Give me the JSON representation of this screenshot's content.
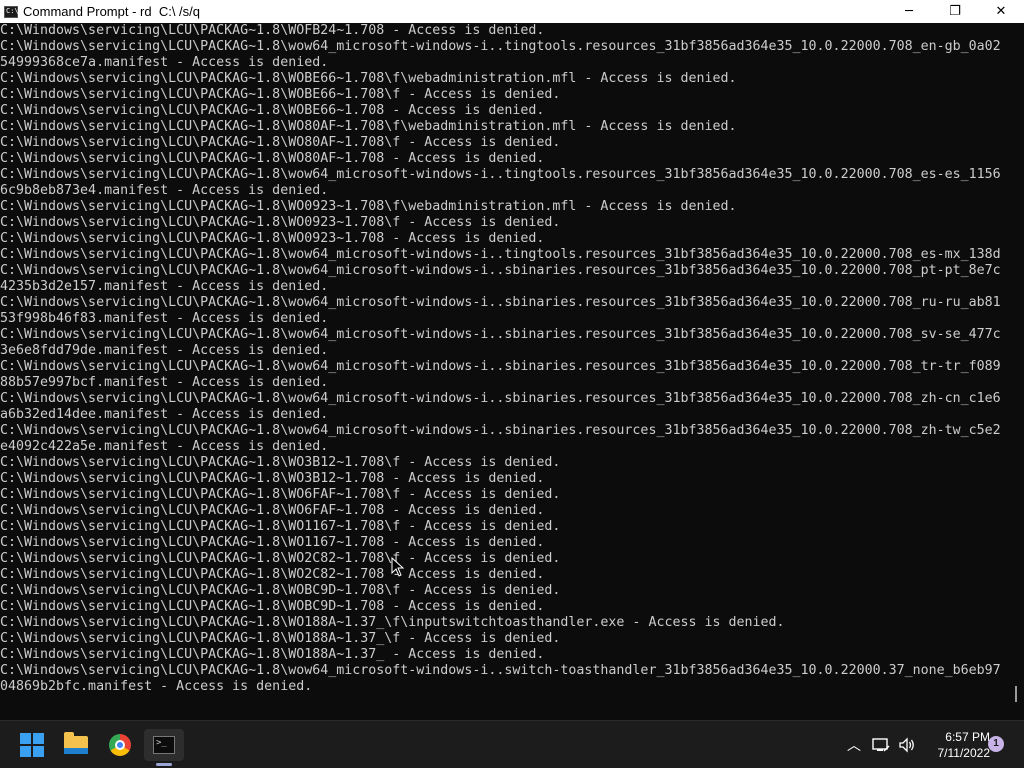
{
  "window": {
    "title": "Command Prompt - rd  C:\\ /s/q",
    "app_icon": "cmd-icon",
    "controls": {
      "minimize": "─",
      "maximize": "❐",
      "close": "✕"
    }
  },
  "console": {
    "lines": [
      "C:\\Windows\\servicing\\LCU\\PACKAG~1.8\\WOFB24~1.708 - Access is denied.",
      "C:\\Windows\\servicing\\LCU\\PACKAG~1.8\\wow64_microsoft-windows-i..tingtools.resources_31bf3856ad364e35_10.0.22000.708_en-gb_0a02",
      "54999368ce7a.manifest - Access is denied.",
      "C:\\Windows\\servicing\\LCU\\PACKAG~1.8\\WOBE66~1.708\\f\\webadministration.mfl - Access is denied.",
      "C:\\Windows\\servicing\\LCU\\PACKAG~1.8\\WOBE66~1.708\\f - Access is denied.",
      "C:\\Windows\\servicing\\LCU\\PACKAG~1.8\\WOBE66~1.708 - Access is denied.",
      "C:\\Windows\\servicing\\LCU\\PACKAG~1.8\\WO80AF~1.708\\f\\webadministration.mfl - Access is denied.",
      "C:\\Windows\\servicing\\LCU\\PACKAG~1.8\\WO80AF~1.708\\f - Access is denied.",
      "C:\\Windows\\servicing\\LCU\\PACKAG~1.8\\WO80AF~1.708 - Access is denied.",
      "C:\\Windows\\servicing\\LCU\\PACKAG~1.8\\wow64_microsoft-windows-i..tingtools.resources_31bf3856ad364e35_10.0.22000.708_es-es_1156",
      "6c9b8eb873e4.manifest - Access is denied.",
      "C:\\Windows\\servicing\\LCU\\PACKAG~1.8\\WO0923~1.708\\f\\webadministration.mfl - Access is denied.",
      "C:\\Windows\\servicing\\LCU\\PACKAG~1.8\\WO0923~1.708\\f - Access is denied.",
      "C:\\Windows\\servicing\\LCU\\PACKAG~1.8\\WO0923~1.708 - Access is denied.",
      "C:\\Windows\\servicing\\LCU\\PACKAG~1.8\\wow64_microsoft-windows-i..tingtools.resources_31bf3856ad364e35_10.0.22000.708_es-mx_138d",
      "C:\\Windows\\servicing\\LCU\\PACKAG~1.8\\wow64_microsoft-windows-i..sbinaries.resources_31bf3856ad364e35_10.0.22000.708_pt-pt_8e7c",
      "4235b3d2e157.manifest - Access is denied.",
      "C:\\Windows\\servicing\\LCU\\PACKAG~1.8\\wow64_microsoft-windows-i..sbinaries.resources_31bf3856ad364e35_10.0.22000.708_ru-ru_ab81",
      "53f998b46f83.manifest - Access is denied.",
      "C:\\Windows\\servicing\\LCU\\PACKAG~1.8\\wow64_microsoft-windows-i..sbinaries.resources_31bf3856ad364e35_10.0.22000.708_sv-se_477c",
      "3e6e8fdd79de.manifest - Access is denied.",
      "C:\\Windows\\servicing\\LCU\\PACKAG~1.8\\wow64_microsoft-windows-i..sbinaries.resources_31bf3856ad364e35_10.0.22000.708_tr-tr_f089",
      "88b57e997bcf.manifest - Access is denied.",
      "C:\\Windows\\servicing\\LCU\\PACKAG~1.8\\wow64_microsoft-windows-i..sbinaries.resources_31bf3856ad364e35_10.0.22000.708_zh-cn_c1e6",
      "a6b32ed14dee.manifest - Access is denied.",
      "C:\\Windows\\servicing\\LCU\\PACKAG~1.8\\wow64_microsoft-windows-i..sbinaries.resources_31bf3856ad364e35_10.0.22000.708_zh-tw_c5e2",
      "e4092c422a5e.manifest - Access is denied.",
      "C:\\Windows\\servicing\\LCU\\PACKAG~1.8\\WO3B12~1.708\\f - Access is denied.",
      "C:\\Windows\\servicing\\LCU\\PACKAG~1.8\\WO3B12~1.708 - Access is denied.",
      "C:\\Windows\\servicing\\LCU\\PACKAG~1.8\\WO6FAF~1.708\\f - Access is denied.",
      "C:\\Windows\\servicing\\LCU\\PACKAG~1.8\\WO6FAF~1.708 - Access is denied.",
      "C:\\Windows\\servicing\\LCU\\PACKAG~1.8\\WO1167~1.708\\f - Access is denied.",
      "C:\\Windows\\servicing\\LCU\\PACKAG~1.8\\WO1167~1.708 - Access is denied.",
      "C:\\Windows\\servicing\\LCU\\PACKAG~1.8\\WO2C82~1.708\\f - Access is denied.",
      "C:\\Windows\\servicing\\LCU\\PACKAG~1.8\\WO2C82~1.708 - Access is denied.",
      "C:\\Windows\\servicing\\LCU\\PACKAG~1.8\\WOBC9D~1.708\\f - Access is denied.",
      "C:\\Windows\\servicing\\LCU\\PACKAG~1.8\\WOBC9D~1.708 - Access is denied.",
      "C:\\Windows\\servicing\\LCU\\PACKAG~1.8\\WO188A~1.37_\\f\\inputswitchtoasthandler.exe - Access is denied.",
      "C:\\Windows\\servicing\\LCU\\PACKAG~1.8\\WO188A~1.37_\\f - Access is denied.",
      "C:\\Windows\\servicing\\LCU\\PACKAG~1.8\\WO188A~1.37_ - Access is denied.",
      "C:\\Windows\\servicing\\LCU\\PACKAG~1.8\\wow64_microsoft-windows-i..switch-toasthandler_31bf3856ad364e35_10.0.22000.37_none_b6eb97",
      "04869b2bfc.manifest - Access is denied."
    ]
  },
  "taskbar": {
    "apps": [
      {
        "name": "start-button",
        "icon": "windows-logo-icon"
      },
      {
        "name": "file-explorer",
        "icon": "folder-icon"
      },
      {
        "name": "chrome",
        "icon": "chrome-icon"
      },
      {
        "name": "command-prompt",
        "icon": "terminal-icon",
        "active": true
      }
    ],
    "tray": {
      "chevron": "︿",
      "network_icon": "network-icon",
      "volume_icon": "volume-icon",
      "time": "6:57 PM",
      "date": "7/11/2022",
      "notification_count": "1"
    }
  },
  "colors": {
    "console_bg": "#0c0c0c",
    "console_text": "#cccccc",
    "taskbar_bg": "#1c1c1c",
    "accent": "#3aa0f2"
  }
}
